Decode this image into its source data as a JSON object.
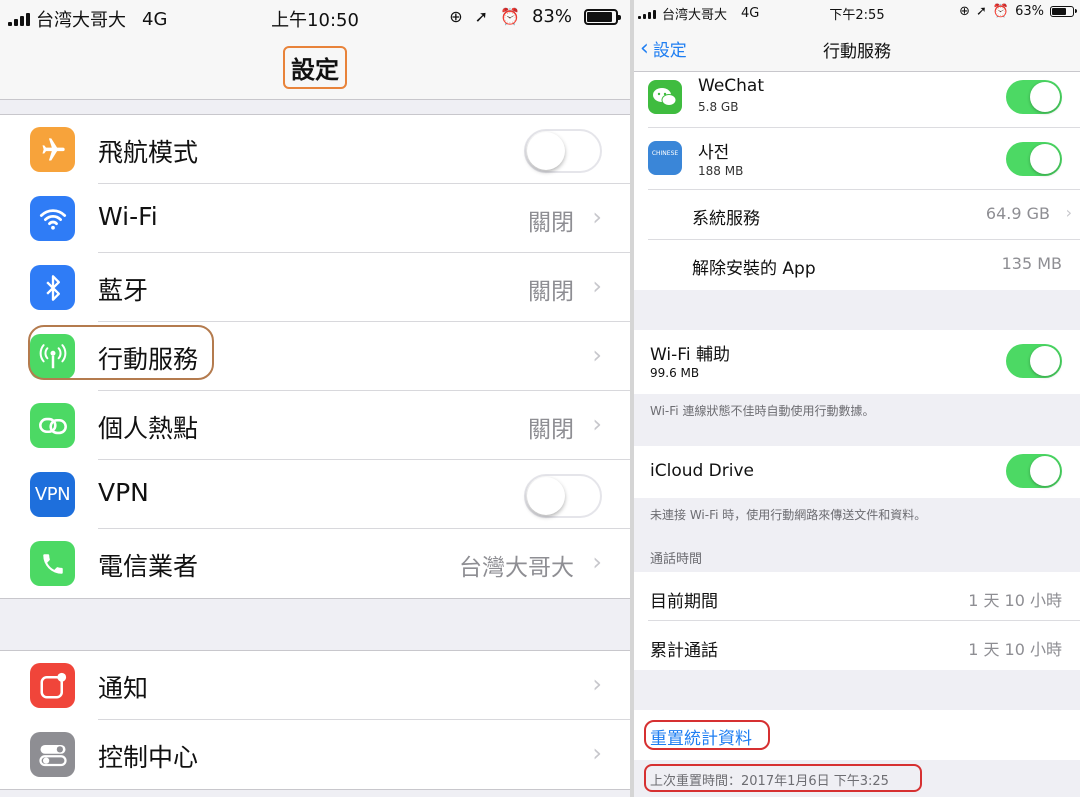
{
  "left": {
    "status": {
      "carrier": "台湾大哥大",
      "network": "4G",
      "time": "上午10:50",
      "battery": "83%",
      "battery_level": 0.83
    },
    "title": "設定",
    "group1": [
      {
        "icon": "airplane-icon",
        "color": "#f7a33b",
        "label": "飛航模式",
        "control": "switch-off"
      },
      {
        "icon": "wifi-icon",
        "color": "#2f7cf6",
        "label": "Wi-Fi",
        "value": "關閉"
      },
      {
        "icon": "bluetooth-icon",
        "color": "#2f7cf6",
        "label": "藍牙",
        "value": "關閉"
      },
      {
        "icon": "antenna-icon",
        "color": "#4cd964",
        "label": "行動服務",
        "value": ""
      },
      {
        "icon": "hotspot-icon",
        "color": "#4cd964",
        "label": "個人熱點",
        "value": "關閉"
      },
      {
        "icon": "vpn-icon",
        "color": "#1e6fdc",
        "icon_text": "VPN",
        "label": "VPN",
        "control": "switch-off"
      },
      {
        "icon": "phone-icon",
        "color": "#4cd964",
        "label": "電信業者",
        "value": "台灣大哥大"
      }
    ],
    "group2": [
      {
        "icon": "notification-icon",
        "color": "#f0453a",
        "label": "通知"
      },
      {
        "icon": "control-center-icon",
        "color": "#8e8e93",
        "label": "控制中心"
      }
    ]
  },
  "right": {
    "status": {
      "carrier": "台湾大哥大",
      "network": "4G",
      "time": "下午2:55",
      "battery": "63%",
      "battery_level": 0.63
    },
    "back_label": "設定",
    "title": "行動服務",
    "apps": [
      {
        "icon": "wechat-icon",
        "name": "WeChat",
        "size": "5.8 GB"
      },
      {
        "icon": "dictionary-icon",
        "name": "사전",
        "size": "188 MB"
      }
    ],
    "system_services": {
      "label": "系統服務",
      "value": "64.9 GB"
    },
    "uninstalled_apps": {
      "label": "解除安裝的 App",
      "value": "135 MB"
    },
    "wifi_assist": {
      "label": "Wi-Fi 輔助",
      "size": "99.6 MB",
      "note": "Wi-Fi 連線狀態不佳時自動使用行動數據。"
    },
    "icloud_drive": {
      "label": "iCloud Drive",
      "note": "未連接 Wi-Fi 時，使用行動網路來傳送文件和資料。"
    },
    "call_time_header": "通話時間",
    "current_period": {
      "label": "目前期間",
      "value": "1 天 10 小時"
    },
    "lifetime": {
      "label": "累計通話",
      "value": "1 天 10 小時"
    },
    "reset_label": "重置統計資料",
    "last_reset": "上次重置時間：2017年1月6日 下午3:25"
  }
}
